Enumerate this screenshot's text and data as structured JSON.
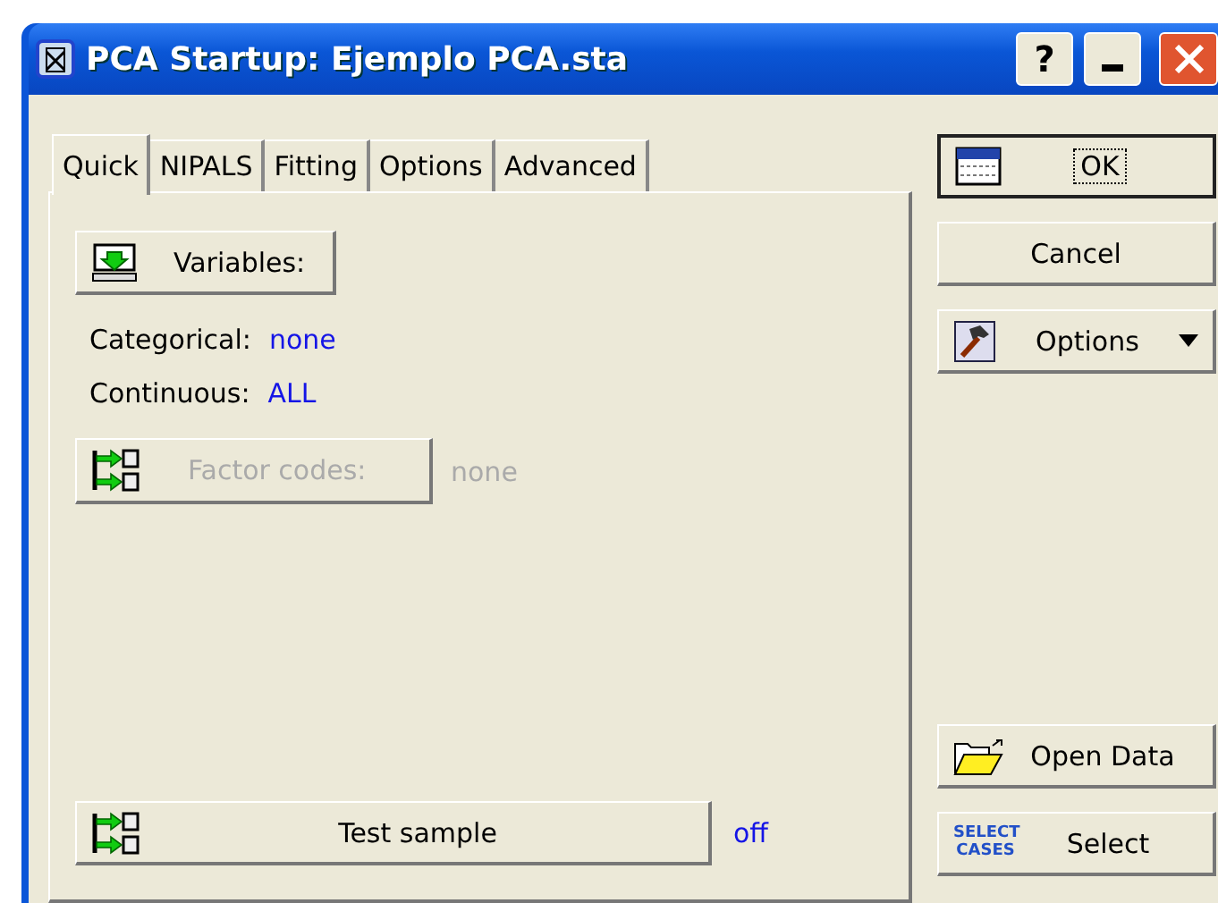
{
  "window": {
    "title": "PCA Startup: Ejemplo PCA.sta",
    "title_buttons": [
      {
        "kind": "help",
        "label": "?"
      },
      {
        "kind": "minimize"
      },
      {
        "kind": "close"
      }
    ]
  },
  "tabs": [
    {
      "label": "Quick",
      "selected": true
    },
    {
      "label": "NIPALS",
      "selected": false
    },
    {
      "label": "Fitting",
      "selected": false
    },
    {
      "label": "Options",
      "selected": false
    },
    {
      "label": "Advanced",
      "selected": false
    }
  ],
  "quick": {
    "variables_button": {
      "label": "Variables:",
      "disabled": false
    },
    "fields": [
      {
        "label": "Categorical:",
        "value": "none"
      },
      {
        "label": "Continuous:",
        "value": "ALL"
      }
    ],
    "factor_codes": {
      "label": "Factor codes:",
      "disabled": true,
      "value": "none"
    },
    "test_sample": {
      "label": "Test sample",
      "disabled": false,
      "value": "off"
    }
  },
  "top_buttons": [
    {
      "kind": "ok",
      "label": "OK",
      "focused": true
    },
    {
      "kind": "cancel",
      "label": "Cancel",
      "focused": false
    },
    {
      "kind": "options",
      "label": "Options",
      "focused": false
    }
  ],
  "bottom_buttons": [
    {
      "kind": "open",
      "label": "Open Data",
      "focused": false
    },
    {
      "kind": "select",
      "label": "Select",
      "icon_text": "SELECT CASES",
      "focused": false
    }
  ]
}
